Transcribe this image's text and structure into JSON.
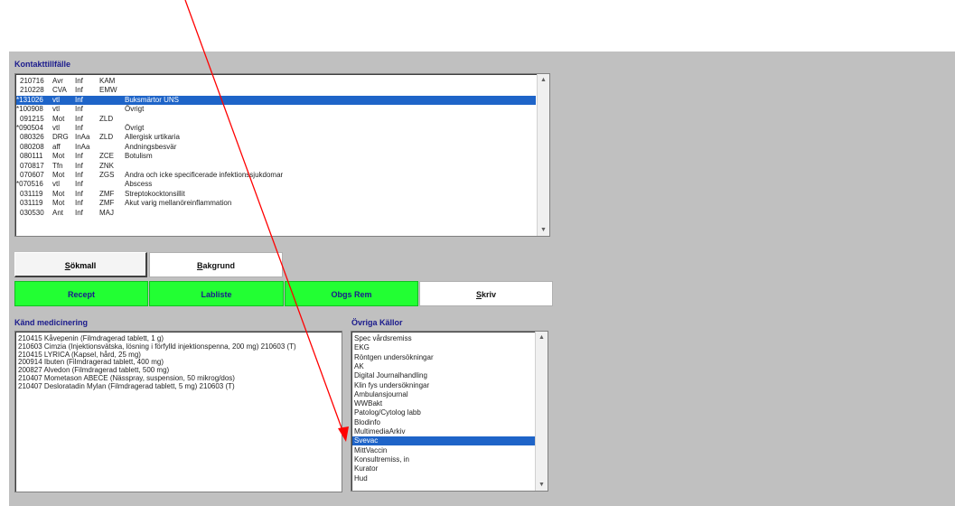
{
  "kontakt": {
    "title": "Kontakttillfälle",
    "rows": [
      {
        "date": "210716",
        "typ": "Avr",
        "kat": "Inf",
        "sig": "KAM",
        "text": "",
        "star": false
      },
      {
        "date": "210228",
        "typ": "CVA",
        "kat": "Inf",
        "sig": "EMW",
        "text": "",
        "star": false
      },
      {
        "date": "131026",
        "typ": "vtl",
        "kat": "Inf",
        "sig": "",
        "text": "Buksmärtor UNS",
        "star": true,
        "selected": true
      },
      {
        "date": "100908",
        "typ": "vtl",
        "kat": "Inf",
        "sig": "",
        "text": "Övrigt",
        "star": true
      },
      {
        "date": "091215",
        "typ": "Mot",
        "kat": "Inf",
        "sig": "ZLD",
        "text": "",
        "star": false
      },
      {
        "date": "090504",
        "typ": "vtl",
        "kat": "Inf",
        "sig": "",
        "text": "Övrigt",
        "star": true
      },
      {
        "date": "080326",
        "typ": "DRG",
        "kat": "InAa",
        "sig": "ZLD",
        "text": "Allergisk urtikaria",
        "star": false
      },
      {
        "date": "080208",
        "typ": "aff",
        "kat": "InAa",
        "sig": "",
        "text": "Andningsbesvär",
        "star": false
      },
      {
        "date": "080111",
        "typ": "Mot",
        "kat": "Inf",
        "sig": "ZCE",
        "text": "Botulism",
        "star": false
      },
      {
        "date": "070817",
        "typ": "Tfn",
        "kat": "Inf",
        "sig": "ZNK",
        "text": "",
        "star": false
      },
      {
        "date": "070607",
        "typ": "Mot",
        "kat": "Inf",
        "sig": "ZGS",
        "text": "Andra och icke specificerade infektionssjukdomar",
        "star": false
      },
      {
        "date": "070516",
        "typ": "vtl",
        "kat": "Inf",
        "sig": "",
        "text": "Abscess",
        "star": true
      },
      {
        "date": "031119",
        "typ": "Mot",
        "kat": "Inf",
        "sig": "ZMF",
        "text": "Streptokocktonsillit",
        "star": false
      },
      {
        "date": "031119",
        "typ": "Mot",
        "kat": "Inf",
        "sig": "ZMF",
        "text": "Akut varig mellanöreinflammation",
        "star": false
      },
      {
        "date": "030530",
        "typ": "Ant",
        "kat": "Inf",
        "sig": "MAJ",
        "text": "",
        "star": false
      }
    ]
  },
  "buttons": {
    "sokmall": {
      "underline": "S",
      "rest": "ökmall"
    },
    "bakgrund": {
      "underline": "B",
      "rest": "akgrund"
    },
    "recept": "Recept",
    "labliste": "Labliste",
    "obgs_rem": "Obgs Rem",
    "skriv": {
      "underline": "S",
      "rest": "kriv"
    }
  },
  "medicinering": {
    "title": "Känd medicinering",
    "lines": [
      "210415 Kåvepenin (Filmdragerad tablett, 1 g)",
      "210603 Cimzia (Injektionsvätska, lösning i förfylld injektionspenna, 200 mg) 210603 (T)",
      "210415 LYRICA (Kapsel, hård, 25 mg)",
      "200914 Ibuten (Filmdragerad tablett, 400 mg)",
      "200827 Alvedon (Filmdragerad tablett, 500 mg)",
      "210407 Mometason ABECE (Nässpray, suspension, 50 mikrog/dos)",
      "210407 Desloratadin Mylan (Filmdragerad tablett, 5 mg) 210603 (T)"
    ]
  },
  "ovriga": {
    "title": "Övriga Källor",
    "items": [
      "Spec vårdsremiss",
      "EKG",
      "Röntgen undersökningar",
      "AK",
      "Digital Journalhandling",
      "Klin fys undersökningar",
      "Ambulansjournal",
      "WWBakt",
      "Patolog/Cytolog labb",
      "Blodinfo",
      "MultimediaArkiv",
      "Svevac",
      "MittVaccin",
      "Konsultremiss, in",
      "Kurator",
      "Hud"
    ],
    "selected_index": 11
  },
  "colors": {
    "arrow": "#ff0000",
    "selection": "#1e64c8",
    "green": "#22ff33"
  }
}
